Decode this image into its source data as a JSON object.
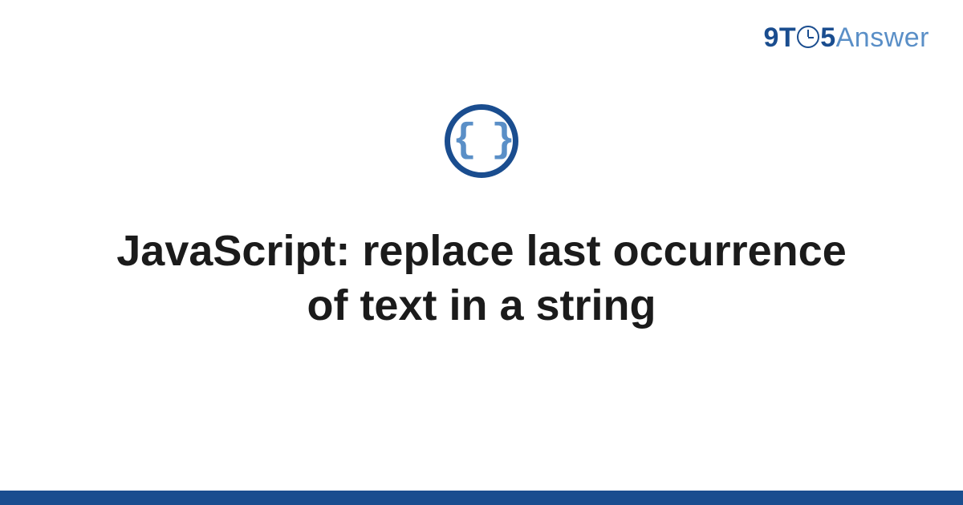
{
  "logo": {
    "part1": "9T",
    "part2": "5",
    "part3": "Answer"
  },
  "icon": {
    "name": "code-braces-icon",
    "glyph": "{ }"
  },
  "title": "JavaScript: replace last occurrence of text in a string",
  "colors": {
    "brand_dark": "#1a4d8f",
    "brand_light": "#5a8fc7",
    "text": "#1b1b1b"
  }
}
